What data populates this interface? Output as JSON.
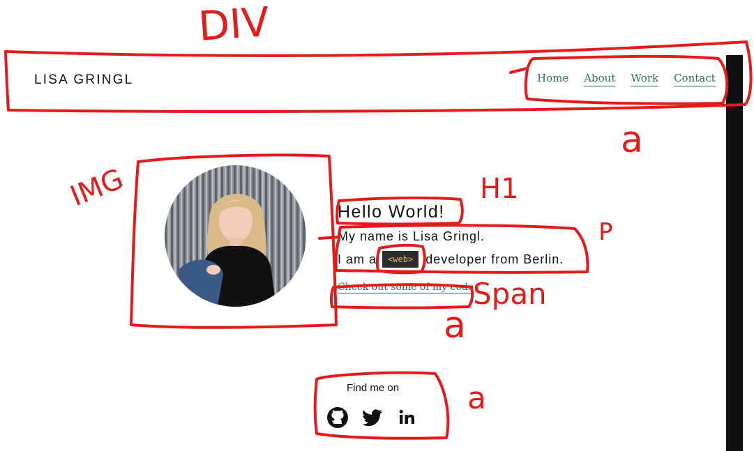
{
  "header": {
    "brand": "LISA GRINGL",
    "nav": [
      {
        "label": "Home"
      },
      {
        "label": "About"
      },
      {
        "label": "Work"
      },
      {
        "label": "Contact"
      }
    ]
  },
  "intro": {
    "title": "Hello World!",
    "line1": "My name is Lisa Gringl.",
    "line2_prefix": "I am a",
    "tag": "<web>",
    "line2_suffix": "developer from Berlin.",
    "code_link": "Check out some of my code"
  },
  "footer": {
    "find_label": "Find me on",
    "social_icons": [
      "github-icon",
      "twitter-icon",
      "linkedin-icon"
    ]
  },
  "annotations": {
    "div": "DIV",
    "img": "IMG",
    "h1": "H1",
    "p": "P",
    "span": "Span",
    "a1": "a",
    "a2": "a",
    "a3": "a",
    "color": "#e31b1b"
  },
  "colors": {
    "link": "#2b6f5e",
    "tag_bg": "#2d2d2d",
    "tag_text": "#e0b85a",
    "annotation": "#e31b1b"
  }
}
